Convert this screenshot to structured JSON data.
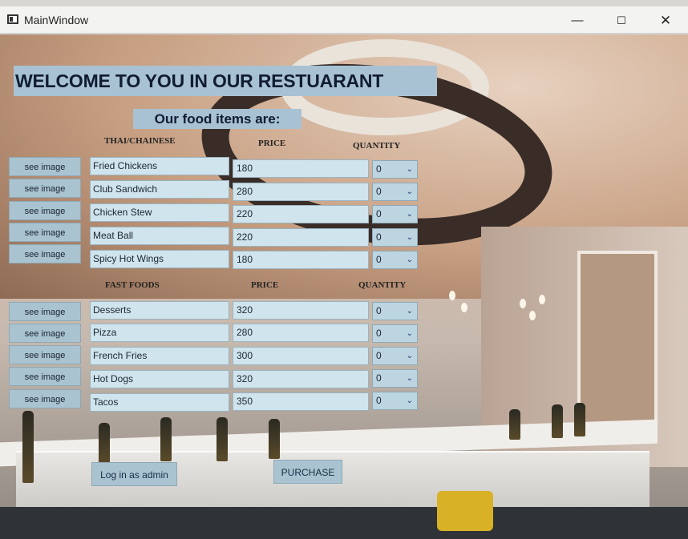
{
  "window": {
    "title": "MainWindow",
    "min_glyph": "—",
    "max_glyph": "☐",
    "close_glyph": "✕"
  },
  "heading": "WELCOME TO YOU IN OUR RESTUARANT",
  "subheading": "Our food items are:",
  "sections": [
    {
      "headers": {
        "name": "THAI/CHAINESE",
        "price": "PRICE",
        "quantity": "QUANTITY"
      },
      "items": [
        {
          "button": "see image",
          "name": "Fried Chickens",
          "price": "180",
          "quantity": "0"
        },
        {
          "button": "see image",
          "name": "Club Sandwich",
          "price": "280",
          "quantity": "0"
        },
        {
          "button": "see image",
          "name": "Chicken Stew",
          "price": "220",
          "quantity": "0"
        },
        {
          "button": "see image",
          "name": "Meat Ball",
          "price": "220",
          "quantity": "0"
        },
        {
          "button": "see image",
          "name": "Spicy Hot Wings",
          "price": "180",
          "quantity": "0"
        }
      ]
    },
    {
      "headers": {
        "name": "FAST FOODS",
        "price": "PRICE",
        "quantity": "QUANTITY"
      },
      "items": [
        {
          "button": "see image",
          "name": "Desserts",
          "price": "320",
          "quantity": "0"
        },
        {
          "button": "see image",
          "name": "Pizza",
          "price": "280",
          "quantity": "0"
        },
        {
          "button": "see image",
          "name": "French Fries",
          "price": "300",
          "quantity": "0"
        },
        {
          "button": "see image",
          "name": "Hot Dogs",
          "price": "320",
          "quantity": "0"
        },
        {
          "button": "see image",
          "name": "Tacos",
          "price": "350",
          "quantity": "0"
        }
      ]
    }
  ],
  "buttons": {
    "admin": "Log in as admin",
    "purchase": "PURCHASE"
  },
  "icons": {
    "dropdown": "chevron-down-icon"
  },
  "colors": {
    "widget_bg": "#a9c3d1",
    "field_bg": "#cfe4ec",
    "heading_text": "#111c33"
  }
}
